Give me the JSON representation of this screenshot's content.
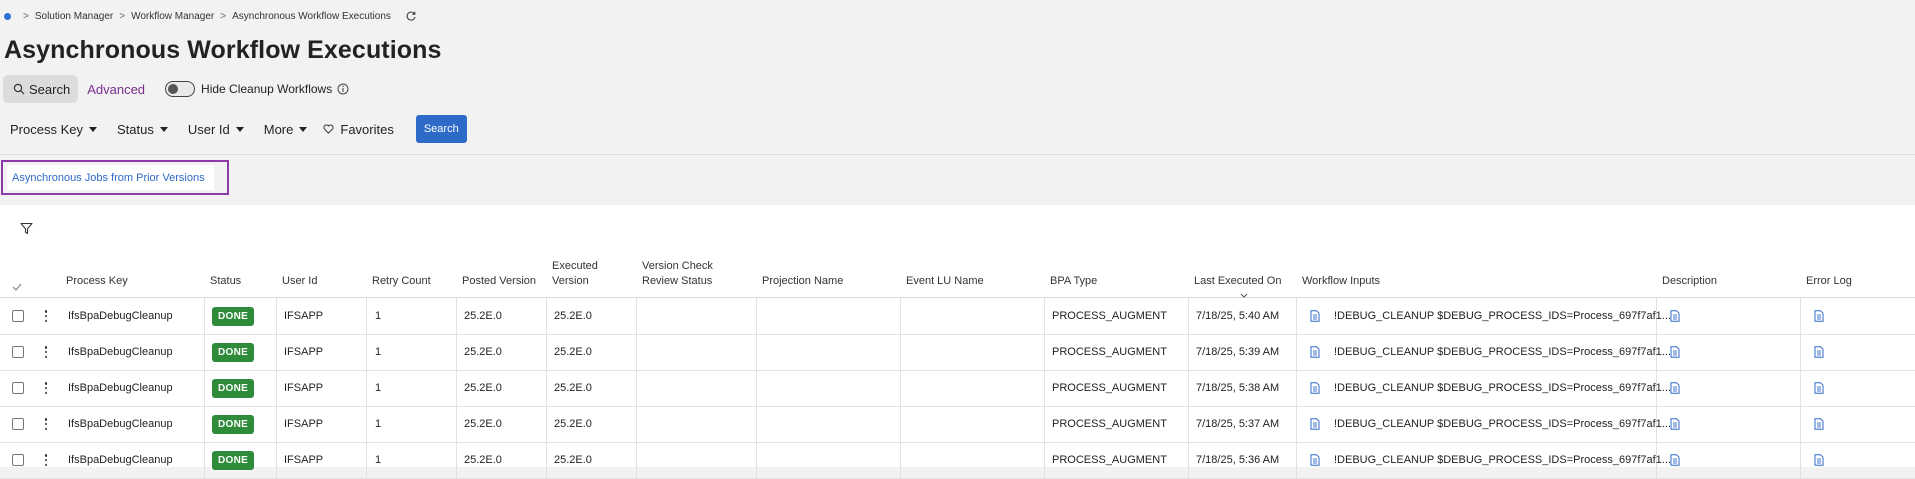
{
  "breadcrumb": {
    "items": [
      "Solution Manager",
      "Workflow Manager",
      "Asynchronous Workflow Executions"
    ]
  },
  "page": {
    "title": "Asynchronous Workflow Executions"
  },
  "search_bar": {
    "search_label": "Search",
    "advanced_label": "Advanced",
    "hide_cleanup_label": "Hide Cleanup Workflows",
    "hide_cleanup_on": false
  },
  "filters": {
    "items": [
      "Process Key",
      "Status",
      "User Id",
      "More"
    ],
    "favorites_label": "Favorites",
    "search_button": "Search"
  },
  "tabs": {
    "prior_versions": "Asynchronous Jobs from Prior Versions"
  },
  "table": {
    "columns": {
      "process_key": "Process Key",
      "status": "Status",
      "user_id": "User Id",
      "retry_count": "Retry Count",
      "posted_version": "Posted Version",
      "executed_version_1": "Executed",
      "executed_version_2": "Version",
      "version_check_1": "Version Check",
      "version_check_2": "Review Status",
      "projection_name": "Projection Name",
      "event_lu_name": "Event LU Name",
      "bpa_type": "BPA Type",
      "last_executed_on": "Last Executed On",
      "workflow_inputs": "Workflow Inputs",
      "description": "Description",
      "error_log": "Error Log"
    },
    "rows": [
      {
        "process_key": "IfsBpaDebugCleanup",
        "status": "DONE",
        "user_id": "IFSAPP",
        "retry_count": "1",
        "posted_version": "25.2E.0",
        "executed_version": "25.2E.0",
        "bpa_type": "PROCESS_AUGMENT",
        "last_executed_on": "7/18/25, 5:40 AM",
        "workflow_inputs": "!DEBUG_CLEANUP $DEBUG_PROCESS_IDS=Process_697f7af1..."
      },
      {
        "process_key": "IfsBpaDebugCleanup",
        "status": "DONE",
        "user_id": "IFSAPP",
        "retry_count": "1",
        "posted_version": "25.2E.0",
        "executed_version": "25.2E.0",
        "bpa_type": "PROCESS_AUGMENT",
        "last_executed_on": "7/18/25, 5:39 AM",
        "workflow_inputs": "!DEBUG_CLEANUP $DEBUG_PROCESS_IDS=Process_697f7af1..."
      },
      {
        "process_key": "IfsBpaDebugCleanup",
        "status": "DONE",
        "user_id": "IFSAPP",
        "retry_count": "1",
        "posted_version": "25.2E.0",
        "executed_version": "25.2E.0",
        "bpa_type": "PROCESS_AUGMENT",
        "last_executed_on": "7/18/25, 5:38 AM",
        "workflow_inputs": "!DEBUG_CLEANUP $DEBUG_PROCESS_IDS=Process_697f7af1..."
      },
      {
        "process_key": "IfsBpaDebugCleanup",
        "status": "DONE",
        "user_id": "IFSAPP",
        "retry_count": "1",
        "posted_version": "25.2E.0",
        "executed_version": "25.2E.0",
        "bpa_type": "PROCESS_AUGMENT",
        "last_executed_on": "7/18/25, 5:37 AM",
        "workflow_inputs": "!DEBUG_CLEANUP $DEBUG_PROCESS_IDS=Process_697f7af1..."
      },
      {
        "process_key": "IfsBpaDebugCleanup",
        "status": "DONE",
        "user_id": "IFSAPP",
        "retry_count": "1",
        "posted_version": "25.2E.0",
        "executed_version": "25.2E.0",
        "bpa_type": "PROCESS_AUGMENT",
        "last_executed_on": "7/18/25, 5:36 AM",
        "workflow_inputs": "!DEBUG_CLEANUP $DEBUG_PROCESS_IDS=Process_697f7af1..."
      }
    ]
  },
  "colors": {
    "accent_blue": "#2e6ac8",
    "advanced_purple": "#7a2e8e",
    "highlight_border": "#8c3aa6",
    "status_done": "#2e8b3a"
  },
  "icons": {
    "search": "search-icon",
    "refresh": "refresh-icon",
    "info": "info-icon",
    "favorites": "heart-icon",
    "filter": "filter-icon",
    "document": "document-icon",
    "sort": "sort-down-icon"
  }
}
